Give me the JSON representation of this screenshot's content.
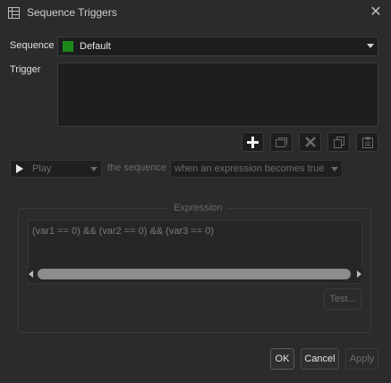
{
  "window": {
    "title": "Sequence Triggers",
    "close_glyph": "✕"
  },
  "form": {
    "sequence_label": "Sequence",
    "sequence_value": "Default",
    "sequence_color": "#1a8a1a",
    "trigger_label": "Trigger"
  },
  "toolbar": {
    "buttons": [
      {
        "name": "add",
        "icon": "plus-icon"
      },
      {
        "name": "duplicate",
        "icon": "duplicate-icon"
      },
      {
        "name": "delete",
        "icon": "delete-x-icon"
      },
      {
        "name": "copy",
        "icon": "copy-icon"
      },
      {
        "name": "paste",
        "icon": "paste-icon"
      }
    ]
  },
  "action_row": {
    "action_value": "Play",
    "middle_text": "the sequence",
    "condition_value": "when an expression becomes true"
  },
  "expression": {
    "group_title": "Expression",
    "text": "(var1 == 0) && (var2 == 0) && (var3 == 0)",
    "test_label": "Test..."
  },
  "dialog_buttons": {
    "ok": "OK",
    "cancel": "Cancel",
    "apply": "Apply"
  }
}
